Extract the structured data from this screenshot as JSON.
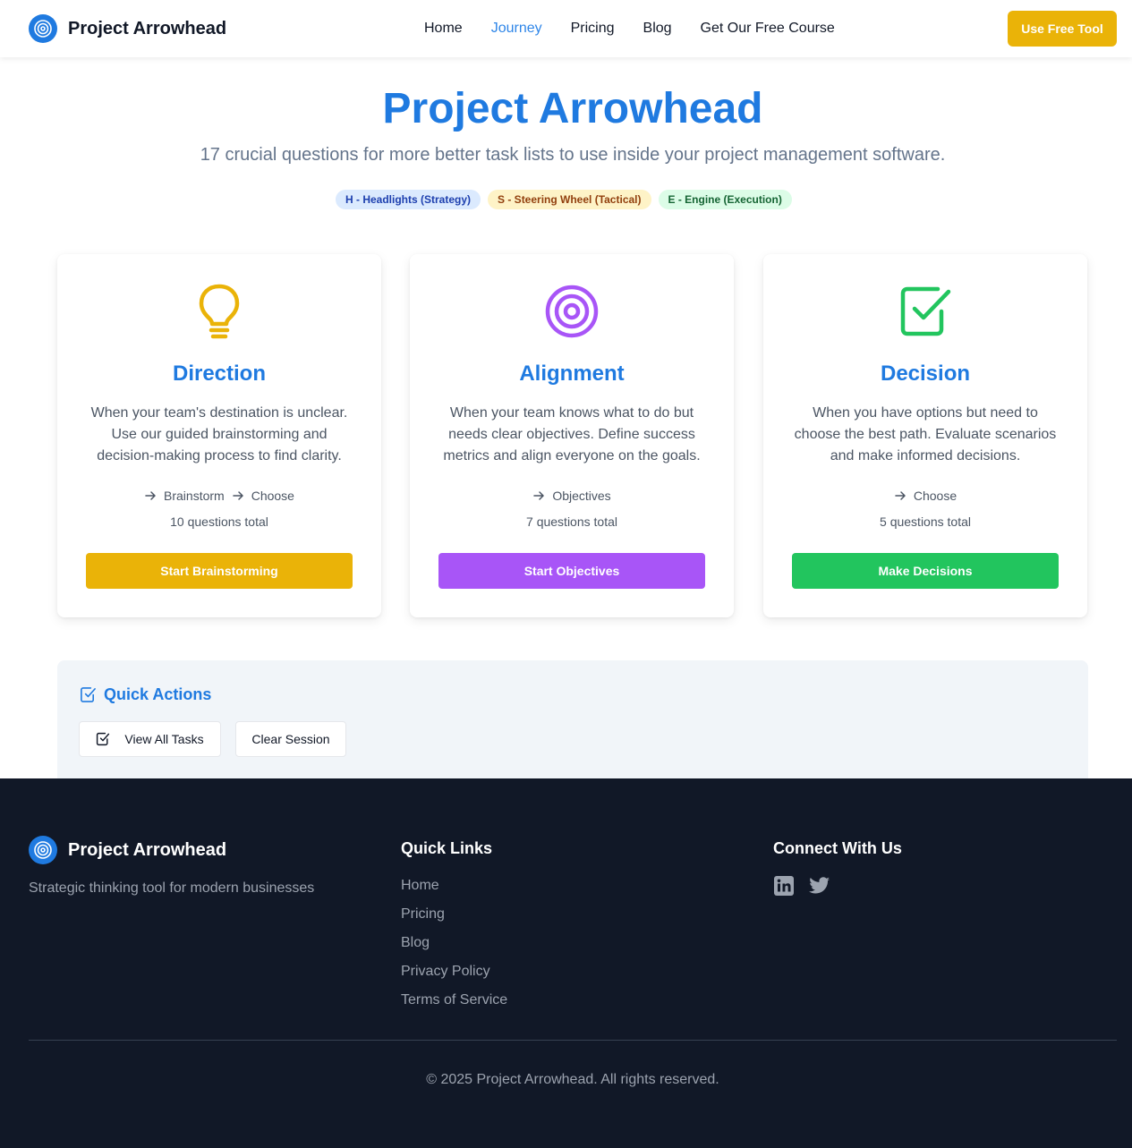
{
  "header": {
    "brand": "Project Arrowhead",
    "nav": [
      "Home",
      "Journey",
      "Pricing",
      "Blog",
      "Get Our Free Course"
    ],
    "active_nav": "Journey",
    "cta": "Use Free Tool"
  },
  "hero": {
    "title": "Project Arrowhead",
    "subtitle": "17 crucial questions for more better task lists to use inside your project management software.",
    "pills": {
      "h": "H - Headlights (Strategy)",
      "s": "S - Steering Wheel (Tactical)",
      "e": "E - Engine (Execution)"
    }
  },
  "cards": [
    {
      "icon": "lightbulb-icon",
      "title": "Direction",
      "description": "When your team's destination is unclear. Use our guided brainstorming and decision-making process to find clarity.",
      "steps": [
        "Brainstorm",
        "Choose"
      ],
      "count": "10 questions total",
      "button": "Start Brainstorming",
      "color": "#eab308"
    },
    {
      "icon": "target-icon",
      "title": "Alignment",
      "description": "When your team knows what to do but needs clear objectives. Define success metrics and align everyone on the goals.",
      "steps": [
        "Objectives"
      ],
      "count": "7 questions total",
      "button": "Start Objectives",
      "color": "#a855f7"
    },
    {
      "icon": "check-square-icon",
      "title": "Decision",
      "description": "When you have options but need to choose the best path. Evaluate scenarios and make informed decisions.",
      "steps": [
        "Choose"
      ],
      "count": "5 questions total",
      "button": "Make Decisions",
      "color": "#22c55e"
    }
  ],
  "quick_actions": {
    "title": "Quick Actions",
    "view_all": "View All Tasks",
    "clear": "Clear Session"
  },
  "footer": {
    "brand": "Project Arrowhead",
    "tagline": "Strategic thinking tool for modern businesses",
    "links_heading": "Quick Links",
    "links": [
      "Home",
      "Pricing",
      "Blog",
      "Privacy Policy",
      "Terms of Service"
    ],
    "connect_heading": "Connect With Us",
    "copyright": "© 2025 Project Arrowhead. All rights reserved."
  },
  "colors": {
    "primary": "#1f7ae0",
    "accent": "#eab308",
    "footer_bg": "#111827"
  }
}
